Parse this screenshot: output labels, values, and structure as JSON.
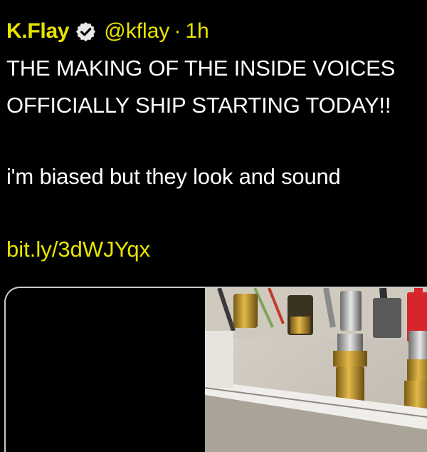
{
  "tweet": {
    "author_name": "K.Flay",
    "handle": "@kflay",
    "separator": "·",
    "time": "1h",
    "lines": [
      "THE MAKING OF THE INSIDE VOICES",
      "OFFICIALLY SHIP STARTING TODAY!!",
      "i'm biased but they look and sound"
    ],
    "link": "bit.ly/3dWJYqx"
  },
  "colors": {
    "background": "#000000",
    "accent": "#e8e400",
    "text": "#ffffff",
    "media_border": "#c9c9c9"
  },
  "icons": {
    "verified": "verified-badge-icon"
  },
  "media": {
    "description": "video-thumbnail"
  }
}
